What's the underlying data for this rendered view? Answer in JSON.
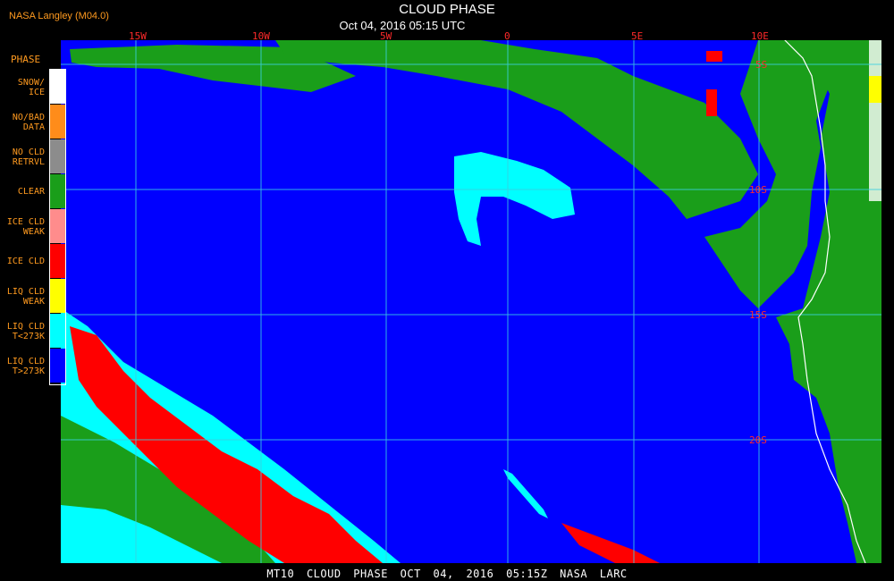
{
  "header": {
    "source": "NASA Langley (M04.0)",
    "title": "CLOUD PHASE",
    "datetime": "Oct 04, 2016 05:15 UTC"
  },
  "legend": {
    "title": "PHASE",
    "items": [
      {
        "label": "SNOW/\nICE",
        "color": "#ffffff"
      },
      {
        "label": "NO/BAD\nDATA",
        "color": "#ff8c1a"
      },
      {
        "label": "NO CLD\nRETRVL",
        "color": "#8c8c8c"
      },
      {
        "label": "CLEAR",
        "color": "#1a9e1a"
      },
      {
        "label": "ICE CLD\nWEAK",
        "color": "#ff8c8c"
      },
      {
        "label": "ICE CLD",
        "color": "#ff0000"
      },
      {
        "label": "LIQ CLD\nWEAK",
        "color": "#ffff00"
      },
      {
        "label": "LIQ CLD\nT<273K",
        "color": "#00ffff"
      },
      {
        "label": "LIQ CLD\nT>273K",
        "color": "#0000ff"
      }
    ]
  },
  "map": {
    "longitude_labels": [
      "15W",
      "10W",
      "5W",
      "0",
      "5E",
      "10E"
    ],
    "latitude_labels": [
      "5S",
      "10S",
      "15S",
      "20S"
    ],
    "colors": {
      "ocean": "#0000ff",
      "clear": "#1a9e1a",
      "ice": "#ff0000",
      "liquid_cold": "#00ffff",
      "grid": "#3ad0e0",
      "coast": "#ffffff"
    }
  },
  "footer": {
    "text": "MT10  CLOUD PHASE  OCT 04, 2016 05:15Z  NASA LARC"
  }
}
